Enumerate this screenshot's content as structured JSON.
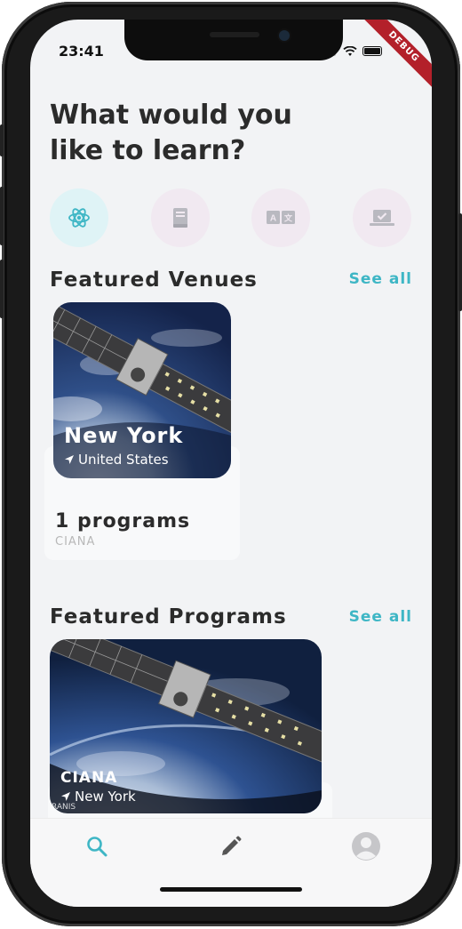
{
  "status_bar": {
    "time": "23:41",
    "debug_label": "DEBUG"
  },
  "header": {
    "title": "What would you like to learn?"
  },
  "categories": [
    {
      "icon": "atom-icon",
      "selected": true,
      "bg": "#dff3f6",
      "color": "#3eb6c5"
    },
    {
      "icon": "book-icon",
      "selected": false,
      "bg": "#f1e9f1",
      "color": "#b9b9c0"
    },
    {
      "icon": "translate-icon",
      "selected": false,
      "bg": "#f1e9f1",
      "color": "#b9b9c0"
    },
    {
      "icon": "laptop-check-icon",
      "selected": false,
      "bg": "#f1e9f1",
      "color": "#b9b9c0"
    }
  ],
  "featured_venues": {
    "title": "Featured Venues",
    "see_all": "See all",
    "items": [
      {
        "city": "New York",
        "country": "United States",
        "programs": "1 programs",
        "org": "CIANA"
      }
    ]
  },
  "featured_programs": {
    "title": "Featured Programs",
    "see_all": "See all",
    "items": [
      {
        "name": "CIANA",
        "city": "New York",
        "partial_text": "RANIS"
      }
    ]
  },
  "bottom_nav": {
    "items": [
      {
        "icon": "search-icon",
        "active": true
      },
      {
        "icon": "pencil-icon",
        "active": false
      },
      {
        "icon": "avatar-icon",
        "active": false
      }
    ]
  },
  "colors": {
    "accent": "#3eb6c5",
    "text_dark": "#2b2b2b",
    "muted": "#b8b8b8",
    "background": "#f2f3f5"
  }
}
